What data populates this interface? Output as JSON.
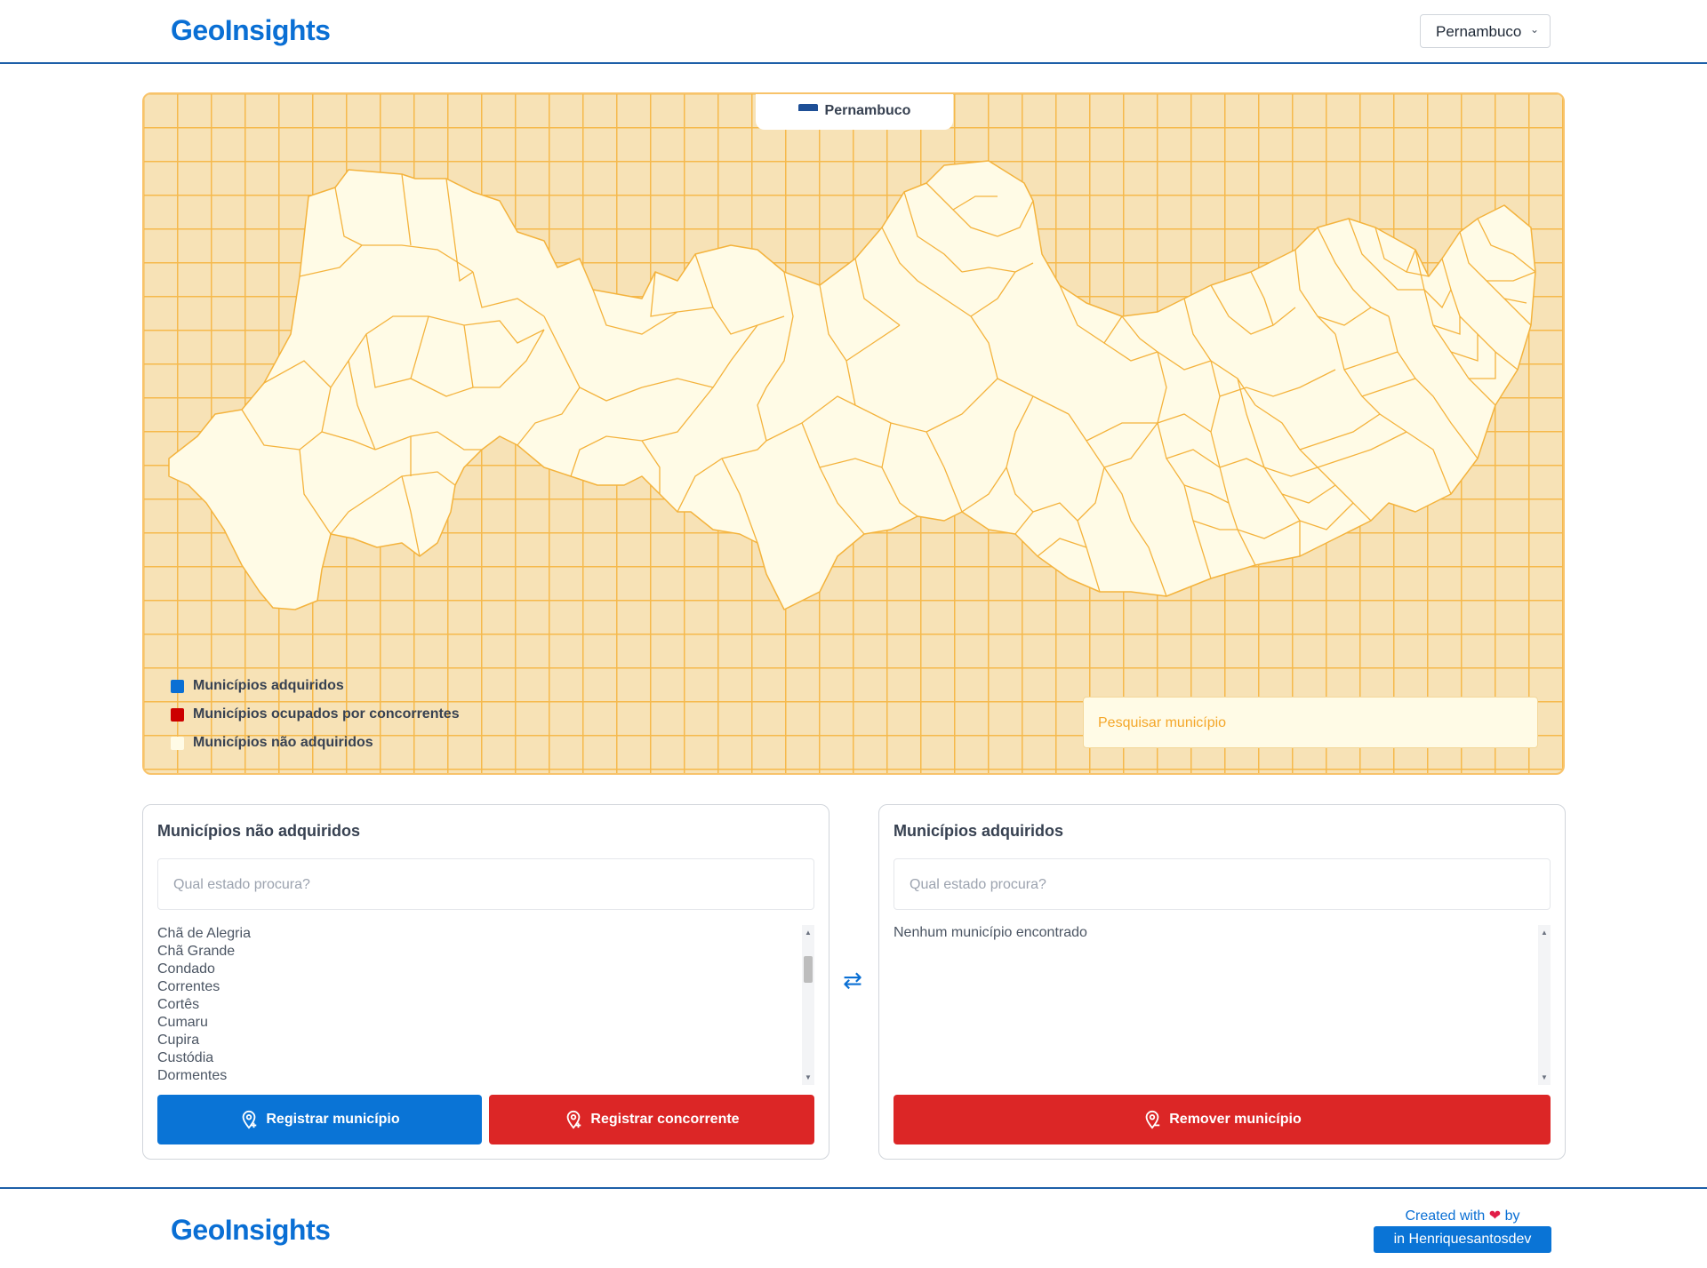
{
  "header": {
    "brand": "GeoInsights",
    "state_select": "Pernambuco"
  },
  "map": {
    "tab_label": "Pernambuco",
    "search_placeholder": "Pesquisar município",
    "legend": [
      {
        "label": "Municípios adquiridos",
        "color": "#0a6fd4"
      },
      {
        "label": "Municípios ocupados por concorrentes",
        "color": "#cc0000"
      },
      {
        "label": "Municípios não adquiridos",
        "color": "#fffbe6"
      }
    ],
    "colors": {
      "background": "#f7e2b6",
      "grid": "#f6b94c",
      "region_fill": "#fffbe6",
      "region_stroke": "#f4b33d"
    }
  },
  "not_acquired": {
    "title": "Municípios não adquiridos",
    "search_placeholder": "Qual estado procura?",
    "items": [
      "Chã de Alegria",
      "Chã Grande",
      "Condado",
      "Correntes",
      "Cortês",
      "Cumaru",
      "Cupira",
      "Custódia",
      "Dormentes"
    ],
    "register_button": "Registrar município",
    "competitor_button": "Registrar concorrente"
  },
  "acquired": {
    "title": "Municípios adquiridos",
    "search_placeholder": "Qual estado procura?",
    "empty_text": "Nenhum município encontrado",
    "remove_button": "Remover município"
  },
  "swap_icon": "⇄",
  "footer": {
    "brand": "GeoInsights",
    "created_prefix": "Created with",
    "created_suffix": "by",
    "author": "Henriquesantosdev"
  }
}
